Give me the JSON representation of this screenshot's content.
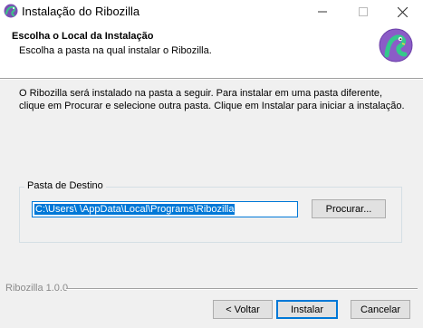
{
  "window": {
    "title": "Instalação do Ribozilla",
    "controls": [
      "minimize-icon",
      "maximize-icon",
      "close-icon"
    ]
  },
  "header": {
    "title": "Escolha o Local da Instalação",
    "subtitle": "Escolha a pasta na qual instalar o Ribozilla.",
    "icon": "ribozilla-logo-icon"
  },
  "body": {
    "description": "O Ribozilla será instalado na pasta a seguir. Para instalar em uma pasta diferente, clique em Procurar e selecione outra pasta. Clique em Instalar para iniciar a instalação."
  },
  "destination": {
    "group_label": "Pasta de Destino",
    "path_value": "C:\\Users\\      \\AppData\\Local\\Programs\\Ribozilla",
    "browse_label": "Procurar..."
  },
  "footer": {
    "brand": "Ribozilla 1.0.0",
    "back_label": "< Voltar",
    "install_label": "Instalar",
    "cancel_label": "Cancelar"
  },
  "colors": {
    "accent": "#0078d7",
    "window_bg": "#f0f0f0",
    "header_bg": "#ffffff"
  }
}
